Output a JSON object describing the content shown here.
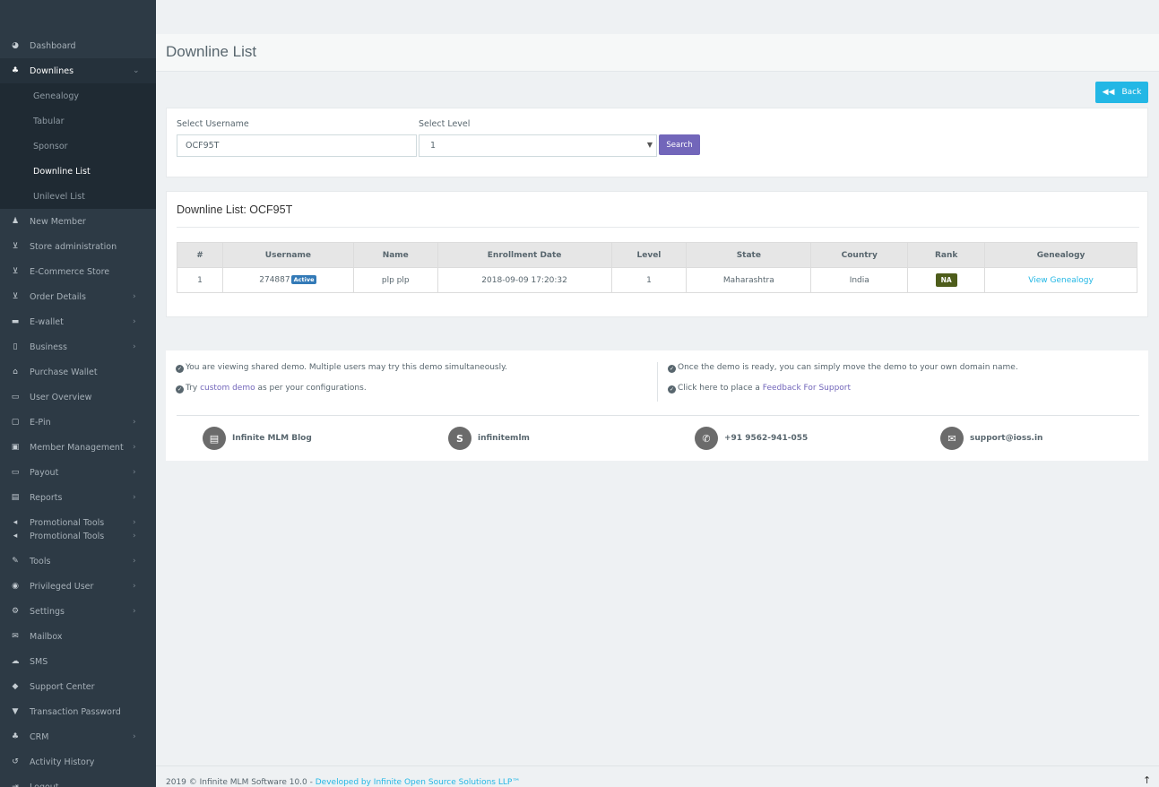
{
  "sidebar": {
    "items": [
      {
        "icon": "tachometer-icon",
        "glyph": "◕",
        "label": "Dashboard",
        "chev": ""
      },
      {
        "icon": "sitemap-icon",
        "glyph": "♣",
        "label": "Downlines",
        "chev": "⌄"
      },
      {
        "icon": "user-plus-icon",
        "glyph": "♟",
        "label": "New Member",
        "chev": ""
      },
      {
        "icon": "cart-icon",
        "glyph": "⊻",
        "label": "Store administration",
        "chev": ""
      },
      {
        "icon": "cart-icon",
        "glyph": "⊻",
        "label": "E-Commerce Store",
        "chev": ""
      },
      {
        "icon": "cart-icon",
        "glyph": "⊻",
        "label": "Order Details",
        "chev": "›"
      },
      {
        "icon": "briefcase-icon",
        "glyph": "▬",
        "label": "E-wallet",
        "chev": "›"
      },
      {
        "icon": "building-icon",
        "glyph": "▯",
        "label": "Business",
        "chev": "›"
      },
      {
        "icon": "wallet-icon",
        "glyph": "⌂",
        "label": "Purchase Wallet",
        "chev": ""
      },
      {
        "icon": "id-card-icon",
        "glyph": "▭",
        "label": "User Overview",
        "chev": ""
      },
      {
        "icon": "bookmark-icon",
        "glyph": "▢",
        "label": "E-Pin",
        "chev": "›"
      },
      {
        "icon": "address-book-icon",
        "glyph": "▣",
        "label": "Member Management",
        "chev": "›"
      },
      {
        "icon": "money-icon",
        "glyph": "▭",
        "label": "Payout",
        "chev": "›"
      },
      {
        "icon": "bar-chart-icon",
        "glyph": "▤",
        "label": "Reports",
        "chev": "›"
      },
      {
        "icon": "bullhorn-icon",
        "glyph": "◂",
        "label": "Promotional Tools",
        "chev": "›"
      },
      {
        "icon": "bullhorn-icon",
        "glyph": "◂",
        "label": "Promotional Tools",
        "chev": "›"
      },
      {
        "icon": "wrench-icon",
        "glyph": "✎",
        "label": "Tools",
        "chev": "›"
      },
      {
        "icon": "user-circle-icon",
        "glyph": "◉",
        "label": "Privileged User",
        "chev": "›"
      },
      {
        "icon": "gears-icon",
        "glyph": "⚙",
        "label": "Settings",
        "chev": "›"
      },
      {
        "icon": "envelope-icon",
        "glyph": "✉",
        "label": "Mailbox",
        "chev": ""
      },
      {
        "icon": "comments-icon",
        "glyph": "☁",
        "label": "SMS",
        "chev": ""
      },
      {
        "icon": "ticket-icon",
        "glyph": "◆",
        "label": "Support Center",
        "chev": ""
      },
      {
        "icon": "shield-icon",
        "glyph": "▼",
        "label": "Transaction Password",
        "chev": ""
      },
      {
        "icon": "users-icon",
        "glyph": "♣",
        "label": "CRM",
        "chev": "›"
      },
      {
        "icon": "history-icon",
        "glyph": "↺",
        "label": "Activity History",
        "chev": ""
      },
      {
        "icon": "sign-out-icon",
        "glyph": "⇥",
        "label": "Logout",
        "chev": ""
      }
    ],
    "submenu": [
      "Genealogy",
      "Tabular",
      "Sponsor",
      "Downline List",
      "Unilevel List"
    ]
  },
  "header": {
    "title": "Downline List"
  },
  "back_button": {
    "label": "Back",
    "icon": "double-left-icon"
  },
  "search_form": {
    "username_label": "Select Username",
    "username_value": "OCF95T",
    "level_label": "Select Level",
    "level_value": "1",
    "search_label": "Search"
  },
  "list": {
    "title": "Downline List: OCF95T",
    "columns": [
      "#",
      "Username",
      "Name",
      "Enrollment Date",
      "Level",
      "State",
      "Country",
      "Rank",
      "Genealogy"
    ],
    "rows": [
      {
        "num": "1",
        "username": "274887",
        "status": "Active",
        "name": "plp plp",
        "date": "2018-09-09 17:20:32",
        "level": "1",
        "state": "Maharashtra",
        "country": "India",
        "rank": "NA",
        "genealogy": "View Genealogy"
      }
    ]
  },
  "demo": {
    "note1": "You are viewing shared demo. Multiple users may try this demo simultaneously.",
    "note2_pre": "Try ",
    "note2_link": "custom demo",
    "note2_post": " as per your configurations.",
    "note3": "Once the demo is ready, you can simply move the demo to your own domain name.",
    "note4_pre": "Click here to place a ",
    "note4_link": "Feedback For Support",
    "contacts": [
      {
        "icon": "newspaper-icon",
        "glyph": "▤",
        "label": "Infinite MLM Blog"
      },
      {
        "icon": "skype-icon",
        "glyph": "S",
        "label": "infinitemlm"
      },
      {
        "icon": "whatsapp-icon",
        "glyph": "✆",
        "label": "+91 9562-941-055"
      },
      {
        "icon": "envelope-icon",
        "glyph": "✉",
        "label": "support@ioss.in"
      }
    ]
  },
  "footer": {
    "text": "2019 © Infinite MLM Software 10.0 - ",
    "link": "Developed by Infinite Open Source Solutions LLP™",
    "scroll_glyph": "↑"
  }
}
